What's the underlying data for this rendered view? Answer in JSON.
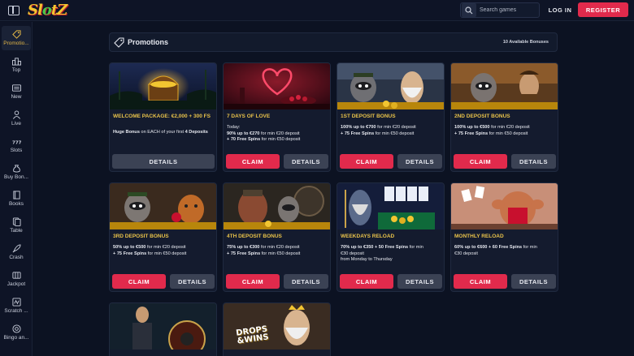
{
  "header": {
    "logo": "SlotZ",
    "search_placeholder": "Search games",
    "login_label": "LOG IN",
    "register_label": "REGISTER"
  },
  "sidebar": {
    "items": [
      {
        "label": "Promotio...",
        "icon": "tag-icon",
        "active": true
      },
      {
        "label": "Top",
        "icon": "podium-icon"
      },
      {
        "label": "New",
        "icon": "new-badge-icon"
      },
      {
        "label": "Live",
        "icon": "person-icon"
      },
      {
        "label": "Slots",
        "icon": "slot-777-icon"
      },
      {
        "label": "Buy Bon...",
        "icon": "money-bag-icon"
      },
      {
        "label": "Books",
        "icon": "book-icon"
      },
      {
        "label": "Table",
        "icon": "cards-icon"
      },
      {
        "label": "Crash",
        "icon": "rocket-icon"
      },
      {
        "label": "Jackpot",
        "icon": "jackpot-icon"
      },
      {
        "label": "Scratch ...",
        "icon": "scratch-icon"
      },
      {
        "label": "Bingo an...",
        "icon": "bingo-icon"
      }
    ]
  },
  "promotions": {
    "title": "Promotions",
    "count_text": "10 Available Bonuses",
    "claim_label": "CLAIM",
    "details_label": "DETAILS",
    "cards": [
      {
        "title": "WELCOME PACKAGE: €2,000 + 300 FS",
        "lines": [
          [
            "Huge Bonus",
            " on EACH of your first ",
            "4 Deposits"
          ]
        ]
      },
      {
        "title": "7 DAYS OF LOVE",
        "lines": [
          [
            "",
            "Today:",
            ""
          ],
          [
            "90% up to €270",
            " for min €20 deposit",
            ""
          ],
          [
            "+ 70 Free Spins",
            " for min €50 deposit",
            ""
          ]
        ]
      },
      {
        "title": "1ST DEPOSIT BONUS",
        "lines": [
          [
            "100% up to €700",
            " for min €20 deposit",
            ""
          ],
          [
            "+ 75 Free Spins",
            " for min €50 deposit",
            ""
          ]
        ]
      },
      {
        "title": "2ND DEPOSIT BONUS",
        "lines": [
          [
            "100% up to €500",
            " for min €20 deposit",
            ""
          ],
          [
            "+ 75 Free Spins",
            " for min €50 deposit",
            ""
          ]
        ]
      },
      {
        "title": "3RD DEPOSIT BONUS",
        "lines": [
          [
            "50% up to €500",
            " for min €20 deposit",
            ""
          ],
          [
            "+ 75 Free Spins",
            " for min €50 deposit",
            ""
          ]
        ]
      },
      {
        "title": "4TH DEPOSIT BONUS",
        "lines": [
          [
            "75% up to €300",
            " for min €20 deposit",
            ""
          ],
          [
            "+ 75 Free Spins",
            " for min €50 deposit",
            ""
          ]
        ]
      },
      {
        "title": "WEEKDAYS RELOAD",
        "lines": [
          [
            "70% up to €350 + 50 Free Spins",
            " for min",
            ""
          ],
          [
            "",
            "€30 deposit",
            ""
          ],
          [
            "",
            "from Monday to Thursday",
            ""
          ]
        ]
      },
      {
        "title": "MONTHLY RELOAD",
        "lines": [
          [
            "60% up to €600 + 60 Free Spins",
            " for min",
            ""
          ],
          [
            "",
            "€30 deposit",
            ""
          ]
        ]
      },
      {
        "title": "",
        "lines": []
      },
      {
        "title": "",
        "lines": []
      }
    ],
    "drops_text": [
      "DROPS",
      "&WINS"
    ]
  },
  "colors": {
    "accent": "#e12a4c",
    "gold": "#e8c24a",
    "background": "#0c1222",
    "card": "#141b2e"
  }
}
